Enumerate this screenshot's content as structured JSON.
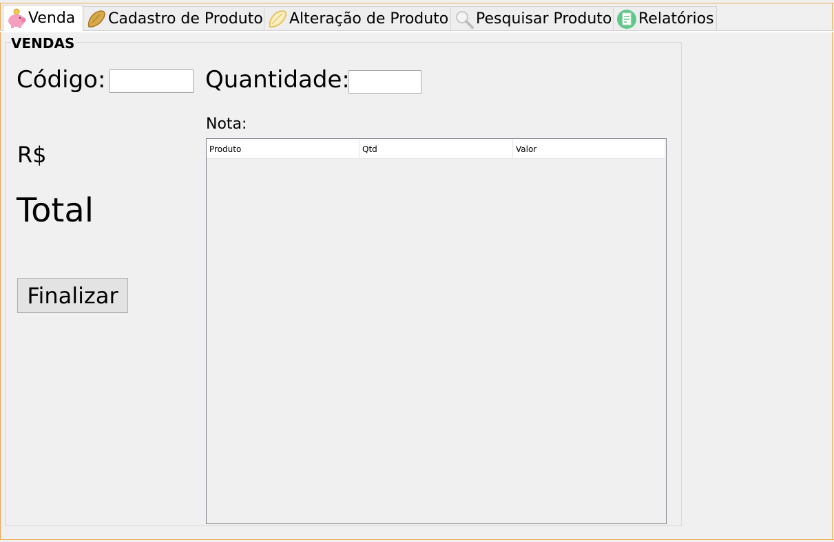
{
  "tabs": [
    {
      "label": "Venda",
      "icon": "piggy-bank-icon",
      "active": true
    },
    {
      "label": "Cadastro de Produto",
      "icon": "pastry-icon",
      "active": false
    },
    {
      "label": "Alteração de Produto",
      "icon": "pastry-outline-icon",
      "active": false
    },
    {
      "label": "Pesquisar Produto",
      "icon": "magnifier-icon",
      "active": false
    },
    {
      "label": "Relatórios",
      "icon": "report-icon",
      "active": false
    }
  ],
  "panel": {
    "title": "VENDAS",
    "codigo_label": "Código:",
    "codigo_value": "",
    "quantidade_label": "Quantidade:",
    "quantidade_value": "",
    "nota_label": "Nota:",
    "currency_label": "R$",
    "total_label": "Total",
    "finalizar_label": "Finalizar",
    "table": {
      "columns": [
        "Produto",
        "Qtd",
        "Valor"
      ],
      "rows": []
    }
  },
  "colors": {
    "window_bg": "#f0f0f0",
    "frame_accent": "#f0a850",
    "piggy": "#f59fbe",
    "pastry": "#c99a3a",
    "report": "#5fc98a"
  }
}
